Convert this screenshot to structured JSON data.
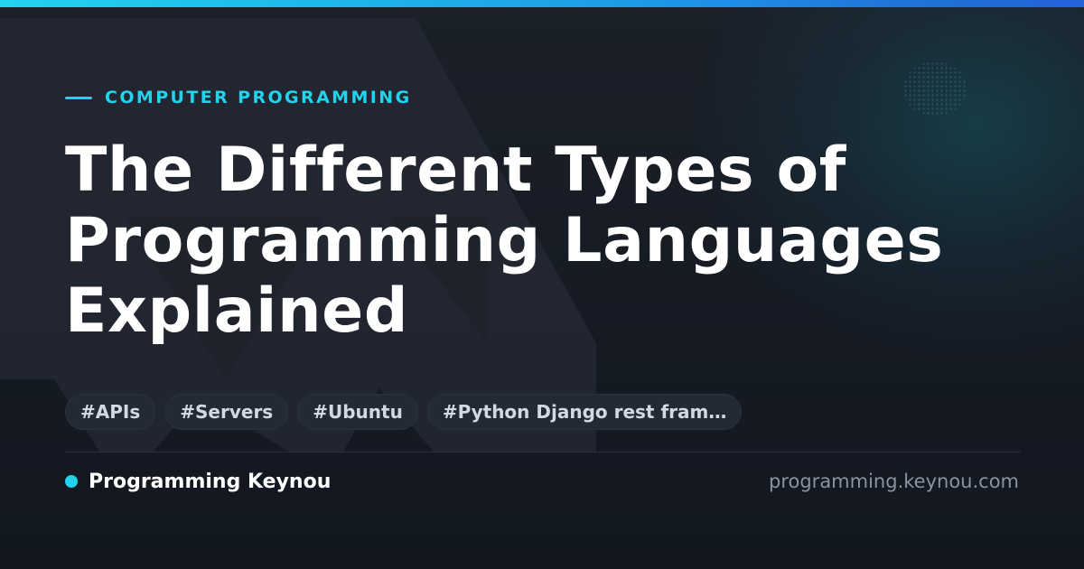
{
  "card": {
    "category": "COMPUTER PROGRAMMING",
    "title": "The Different Types of Programming Languages Explained",
    "tags": [
      "#APIs",
      "#Servers",
      "#Ubuntu",
      "#Python Django rest fram…"
    ],
    "brand_name": "Programming Keynou",
    "domain": "programming.keynou.com"
  },
  "colors": {
    "accent": "#22d3ee",
    "accent_blue": "#2563eb",
    "background": "#161b24",
    "tag_background": "#242a35",
    "muted_text": "#8b92a0"
  },
  "icons": {
    "brand_dot": "dot-icon"
  }
}
